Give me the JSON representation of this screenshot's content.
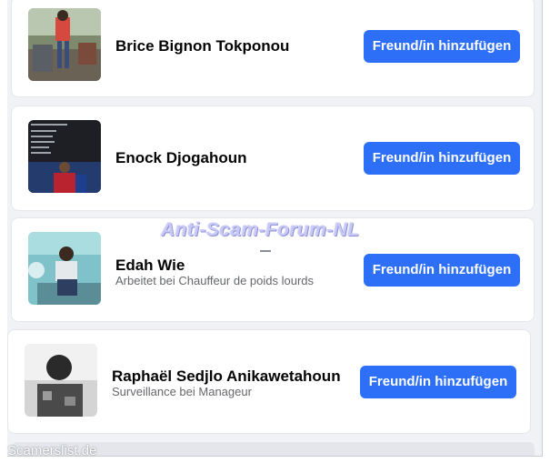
{
  "people": [
    {
      "name": "Brice Bignon Tokponou",
      "subtitle": "",
      "button": "Freund/in hinzufügen"
    },
    {
      "name": "Enock Djogahoun",
      "subtitle": "",
      "button": "Freund/in hinzufügen"
    },
    {
      "name": "Edah Wie",
      "subtitle": "Arbeitet bei Chauffeur de poids lourds",
      "button": "Freund/in hinzufügen"
    },
    {
      "name": "Raphaël Sedjlo Anikawetahoun",
      "subtitle": "Surveillance bei Manageur",
      "button": "Freund/in hinzufügen"
    }
  ],
  "watermarks": {
    "center": "Anti-Scam-Forum-NL",
    "corner": "Scamerslist.de"
  },
  "colors": {
    "button": "#2d6ff7",
    "background": "#f0f2f5",
    "card": "#ffffff"
  }
}
